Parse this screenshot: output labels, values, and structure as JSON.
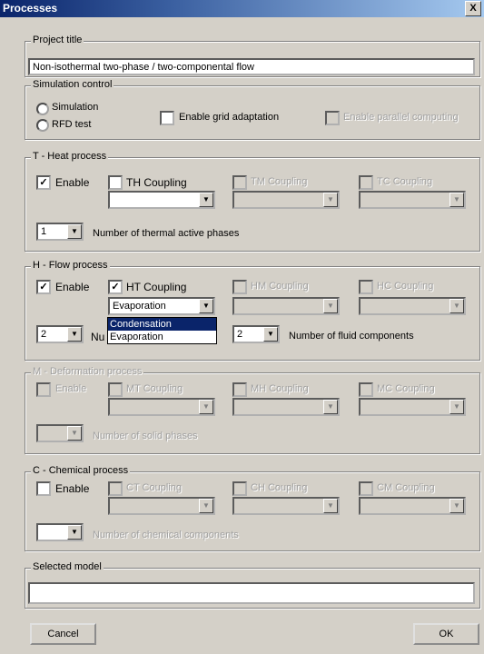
{
  "window": {
    "title": "Processes",
    "close_label": "X"
  },
  "project": {
    "legend": "Project title",
    "value": "Non-isothermal two-phase / two-componental flow"
  },
  "simulation": {
    "legend": "Simulation control",
    "simulation_label": "Simulation",
    "rfd_label": "RFD test",
    "grid_adaptation_label": "Enable grid adaptation",
    "parallel_label": "Enable parallel computing"
  },
  "heat": {
    "legend": "T - Heat process",
    "enable_label": "Enable",
    "enable_checked": "✓",
    "th_label": "TH Coupling",
    "tm_label": "TM Coupling",
    "tc_label": "TC Coupling",
    "count_value": "1",
    "count_label": "Number of thermal active phases"
  },
  "flow": {
    "legend": "H - Flow process",
    "enable_label": "Enable",
    "enable_checked": "✓",
    "ht_label": "HT Coupling",
    "ht_checked": "✓",
    "ht_value": "Evaporation",
    "hm_label": "HM Coupling",
    "hc_label": "HC Coupling",
    "phases_value": "2",
    "phases_label_partial": "Nu",
    "components_value": "2",
    "components_label": "Number of fluid components",
    "dropdown_options": [
      "Condensation",
      "Evaporation"
    ]
  },
  "deformation": {
    "legend": "M - Deformation process",
    "enable_label": "Enable",
    "mt_label": "MT Coupling",
    "mh_label": "MH Coupling",
    "mc_label": "MC Coupling",
    "count_label": "Number of solid phases"
  },
  "chemical": {
    "legend": "C - Chemical process",
    "enable_label": "Enable",
    "ct_label": "CT Coupling",
    "ch_label": "CH Coupling",
    "cm_label": "CM Coupling",
    "count_label": "Number of chemical components"
  },
  "selected": {
    "legend": "Selected model",
    "value": ""
  },
  "buttons": {
    "cancel": "Cancel",
    "ok": "OK"
  }
}
